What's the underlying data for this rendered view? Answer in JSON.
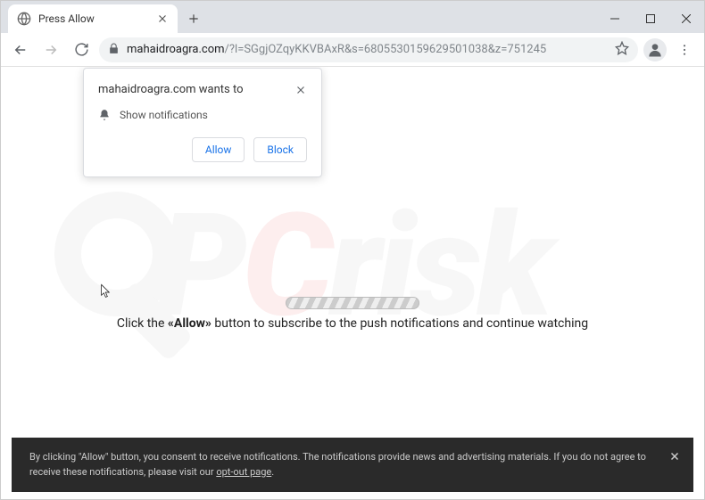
{
  "tab": {
    "title": "Press Allow"
  },
  "address": {
    "host": "mahaidroagra.com",
    "path": "/?l=SGgjOZqyKKVBAxR&s=6805530159629501038&z=751245"
  },
  "permission": {
    "title": "mahaidroagra.com wants to",
    "body": "Show notifications",
    "allow": "Allow",
    "block": "Block"
  },
  "page": {
    "msg_pre": "Click the ",
    "msg_bold": "«Allow»",
    "msg_post": " button to subscribe to the push notifications and continue watching"
  },
  "cookie": {
    "text": "By clicking \"Allow\" button, you consent to receive notifications. The notifications provide news and advertising materials. If you do not agree to receive these notifications, please visit our ",
    "link": "opt-out page",
    "tail": "."
  },
  "watermark": {
    "p": "P",
    "c": "C",
    "risk": "risk"
  }
}
